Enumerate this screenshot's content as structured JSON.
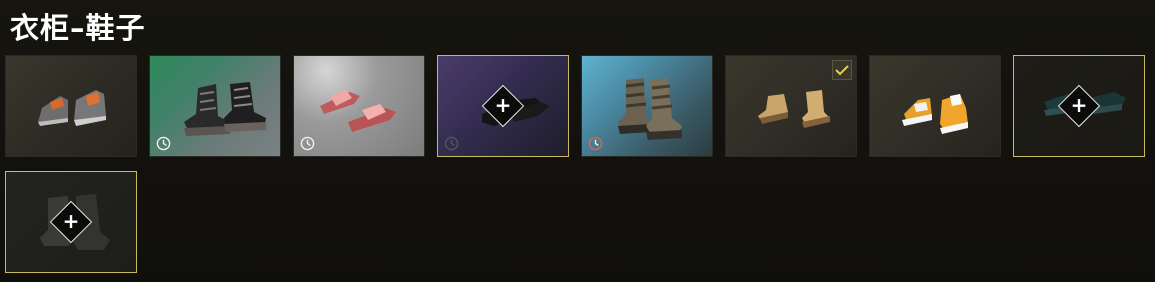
{
  "title": "衣柜–鞋子",
  "colors": {
    "background": "#12110d",
    "selected_border": "#c9b95a",
    "equipped_check": "#e6cf4a",
    "timer_expired": "#e0644a"
  },
  "items": [
    {
      "icon": "sneaker-gray-orange-laces-icon",
      "timed": false,
      "equipped": false,
      "selected": false,
      "add_slot": false
    },
    {
      "icon": "combat-boots-black-icon",
      "timed": true,
      "timer_state": "active",
      "equipped": false,
      "selected": false,
      "add_slot": false
    },
    {
      "icon": "slides-pink-icon",
      "timed": true,
      "timer_state": "active",
      "equipped": false,
      "selected": false,
      "add_slot": false
    },
    {
      "icon": "loafers-black-icon",
      "timed": true,
      "timer_state": "dim",
      "equipped": false,
      "selected": true,
      "add_slot": true,
      "add_glyph": "+"
    },
    {
      "icon": "tall-boots-brown-icon",
      "timed": true,
      "timer_state": "expiring",
      "equipped": false,
      "selected": false,
      "add_slot": false
    },
    {
      "icon": "work-boots-tan-icon",
      "timed": false,
      "equipped": true,
      "selected": false,
      "add_slot": false
    },
    {
      "icon": "sneakers-yellow-icon",
      "timed": false,
      "equipped": false,
      "selected": false,
      "add_slot": false
    },
    {
      "icon": "sneakers-teal-icon",
      "timed": false,
      "equipped": false,
      "selected": true,
      "add_slot": true,
      "add_glyph": "+"
    },
    {
      "icon": "boots-dark-gray-icon",
      "timed": false,
      "equipped": false,
      "selected": true,
      "add_slot": true,
      "add_glyph": "+"
    }
  ]
}
